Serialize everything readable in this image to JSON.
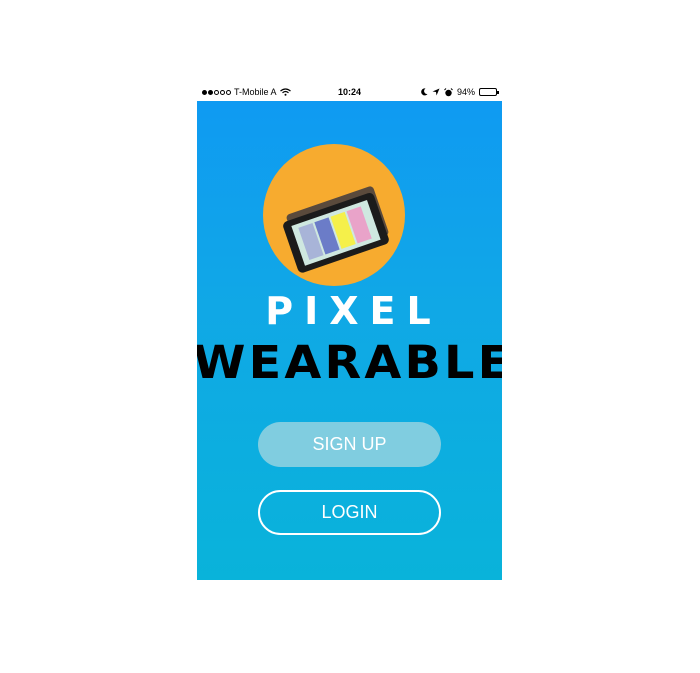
{
  "status_bar": {
    "carrier": "T-Mobile A",
    "time": "10:24",
    "battery": "94%",
    "battery_level": 0.94,
    "icons": [
      "signal-dots-icon",
      "wifi-icon",
      "moon-icon",
      "location-arrow-icon",
      "alarm-icon",
      "battery-icon"
    ]
  },
  "logo": {
    "icon": "tablet-logo-icon",
    "circle_color": "#f7ab2f",
    "stripe_colors": [
      "#a8b4d8",
      "#6b7cc8",
      "#f5f04a",
      "#e9a3c9"
    ]
  },
  "brand": {
    "line1": "PIXEL",
    "line2": "WEARABLES"
  },
  "actions": {
    "signup_label": "SIGN UP",
    "login_label": "LOGIN"
  },
  "colors": {
    "background_top": "#0f99f3",
    "background_bottom": "#09b3da",
    "accent": "#f7ab2f"
  }
}
